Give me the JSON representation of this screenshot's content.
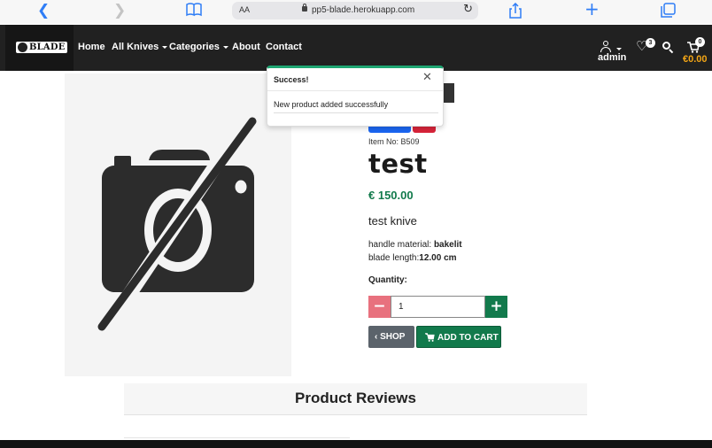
{
  "browser": {
    "aa_label": "AA",
    "url": "pp5-blade.herokuapp.com",
    "icons": [
      "back-icon",
      "forward-icon",
      "bookmarks-icon",
      "lock-icon",
      "reload-icon",
      "share-icon",
      "new-tab-icon",
      "tabs-icon"
    ]
  },
  "navbar": {
    "logo_text": "BLADE",
    "links": {
      "home": "Home",
      "all_knives": "All Knives",
      "categories": "Categories",
      "about": "About",
      "contact": "Contact"
    },
    "account_label": "admin",
    "wishlist_count": "3",
    "cart_count": "0",
    "cart_total": "€0.00",
    "accent_color": "#f2a516"
  },
  "toast": {
    "title": "Success!",
    "message": "New product added successfully",
    "accent_color": "#1ea672"
  },
  "product": {
    "item_no": "Item No: B509",
    "name": "test",
    "price": "€ 150.00",
    "description": "test knive",
    "handle_material_label": "handle material: ",
    "handle_material_value": "bakelit",
    "blade_length_label": "blade length:",
    "blade_length_value": "12.00 cm",
    "quantity_label": "Quantity:",
    "quantity_value": "1",
    "minus_label": "−",
    "plus_label": "+",
    "shop_label": "SHOP",
    "add_to_cart_label": "ADD TO CART",
    "image_icon": "no-image-camera-icon",
    "price_color": "#127a4c"
  },
  "reviews": {
    "title": "Product Reviews"
  }
}
